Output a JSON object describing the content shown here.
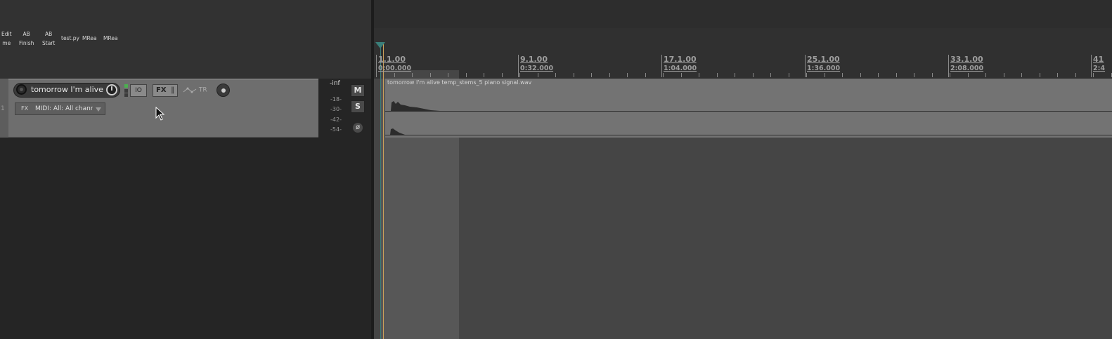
{
  "toolbar": {
    "buttons": [
      {
        "label": "Edit\nme"
      },
      {
        "label": "AB\nFinish"
      },
      {
        "label": "AB\nStart"
      },
      {
        "label": "test.py"
      },
      {
        "label": "MRea"
      },
      {
        "label": "MRea"
      }
    ]
  },
  "track": {
    "number": "1",
    "name": "tomorrow I'm alive t",
    "io_label": "IO",
    "fx_label": "FX",
    "trim_label": "TR",
    "midi_fx_label": "FX",
    "midi_input": "MIDI: All: All channe"
  },
  "meter": {
    "peak": "-inf",
    "ticks": [
      "-18-",
      "-30-",
      "-42-",
      "-54-"
    ],
    "mute_label": "M",
    "solo_label": "S",
    "phase_label": "ø"
  },
  "ruler": {
    "markers": [
      {
        "bar": "1.1.00",
        "time": "0:00.000"
      },
      {
        "bar": "9.1.00",
        "time": "0:32.000"
      },
      {
        "bar": "17.1.00",
        "time": "1:04.000"
      },
      {
        "bar": "25.1.00",
        "time": "1:36.000"
      },
      {
        "bar": "33.1.00",
        "time": "2:08.000"
      },
      {
        "bar": "41",
        "time": "2:4"
      }
    ]
  },
  "item": {
    "title": "tomorrow I'm alive temp_stems_5 piano signal.wav"
  },
  "colors": {
    "playhead": "#c9a05a",
    "edit_cursor": "#3a7f7a",
    "io_led_active": "#4caf50"
  }
}
